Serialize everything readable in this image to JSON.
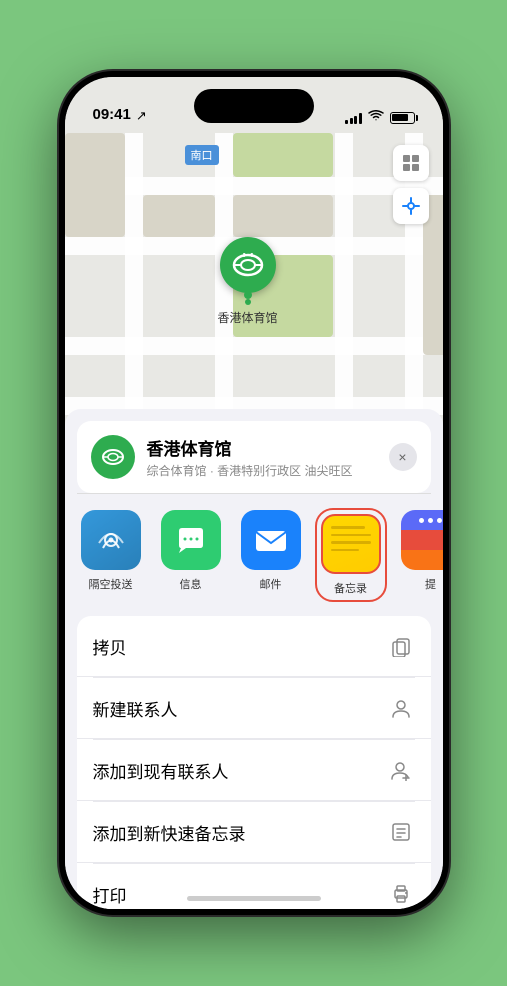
{
  "statusBar": {
    "time": "09:41",
    "hasLocation": true
  },
  "mapLabel": {
    "text": "南口"
  },
  "mapPin": {
    "label": "香港体育馆"
  },
  "venueCard": {
    "name": "香港体育馆",
    "subtitle": "综合体育馆 · 香港特别行政区 油尖旺区",
    "closeLabel": "×"
  },
  "shareItems": [
    {
      "id": "airdrop",
      "label": "隔空投送",
      "style": "airdrop"
    },
    {
      "id": "messages",
      "label": "信息",
      "style": "messages"
    },
    {
      "id": "mail",
      "label": "邮件",
      "style": "mail"
    },
    {
      "id": "notes",
      "label": "备忘录",
      "style": "notes"
    },
    {
      "id": "more",
      "label": "提",
      "style": "more"
    }
  ],
  "actionItems": [
    {
      "id": "copy",
      "label": "拷贝",
      "icon": "📋"
    },
    {
      "id": "new-contact",
      "label": "新建联系人",
      "icon": "👤"
    },
    {
      "id": "add-contact",
      "label": "添加到现有联系人",
      "icon": "➕"
    },
    {
      "id": "quick-note",
      "label": "添加到新快速备忘录",
      "icon": "📝"
    },
    {
      "id": "print",
      "label": "打印",
      "icon": "🖨️"
    }
  ]
}
